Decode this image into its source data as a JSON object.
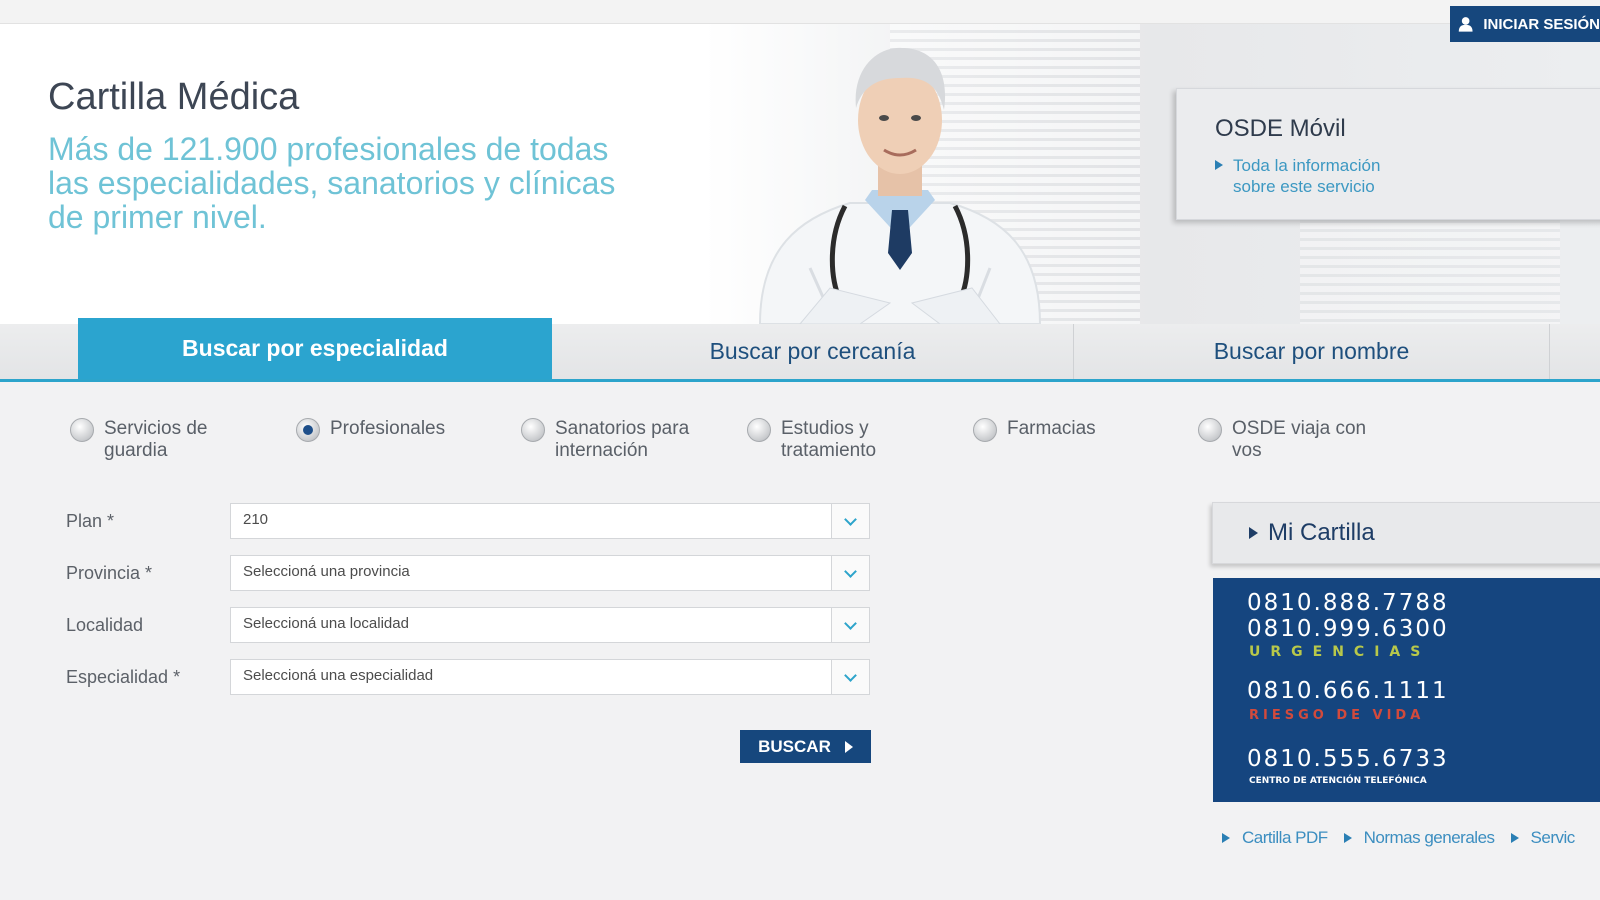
{
  "header": {
    "title": "Cartilla Médica",
    "subtitle": "Más de 121.900 profesionales de todas las especialidades, sanatorios y clínicas de primer nivel.",
    "login_label": "INICIAR SESIÓN",
    "login_icon": "user-icon"
  },
  "osde_movil": {
    "title": "OSDE Móvil",
    "link": "Toda la información sobre este servicio"
  },
  "tabs": [
    {
      "label": "Buscar por especialidad",
      "active": true
    },
    {
      "label": "Buscar por cercanía",
      "active": false
    },
    {
      "label": "Buscar por nombre",
      "active": false
    }
  ],
  "search_types": [
    {
      "label": "Servicios de guardia",
      "selected": false
    },
    {
      "label": "Profesionales",
      "selected": true
    },
    {
      "label": "Sanatorios para internación",
      "selected": false
    },
    {
      "label": "Estudios y tratamiento",
      "selected": false
    },
    {
      "label": "Farmacias",
      "selected": false
    },
    {
      "label": "OSDE viaja con vos",
      "selected": false
    }
  ],
  "form": {
    "plan": {
      "label": "Plan *",
      "value": "210"
    },
    "provincia": {
      "label": "Provincia *",
      "value": "Seleccioná una provincia"
    },
    "localidad": {
      "label": "Localidad",
      "value": "Seleccioná una localidad"
    },
    "especialidad": {
      "label": "Especialidad *",
      "value": "Seleccioná una especialidad"
    },
    "submit_label": "BUSCAR"
  },
  "mi_cartilla": {
    "label": "Mi Cartilla"
  },
  "phones": [
    {
      "number": "0810.888.7788",
      "tag": ""
    },
    {
      "number": "0810.999.6300",
      "tag": "URGENCIAS",
      "tag_color": "#b8c84a"
    },
    {
      "number": "0810.666.1111",
      "tag": "RIESGO DE VIDA",
      "tag_color": "#d24a3c"
    },
    {
      "number": "0810.555.6733",
      "tag": "CENTRO DE ATENCIÓN TELEFÓNICA",
      "tag_color": "#ffffff"
    }
  ],
  "footer_links": [
    "Cartilla PDF",
    "Normas generales",
    "Servic"
  ],
  "colors": {
    "accent": "#2ba4cf",
    "navy": "#16477d",
    "teal_text": "#6fc3d6"
  }
}
